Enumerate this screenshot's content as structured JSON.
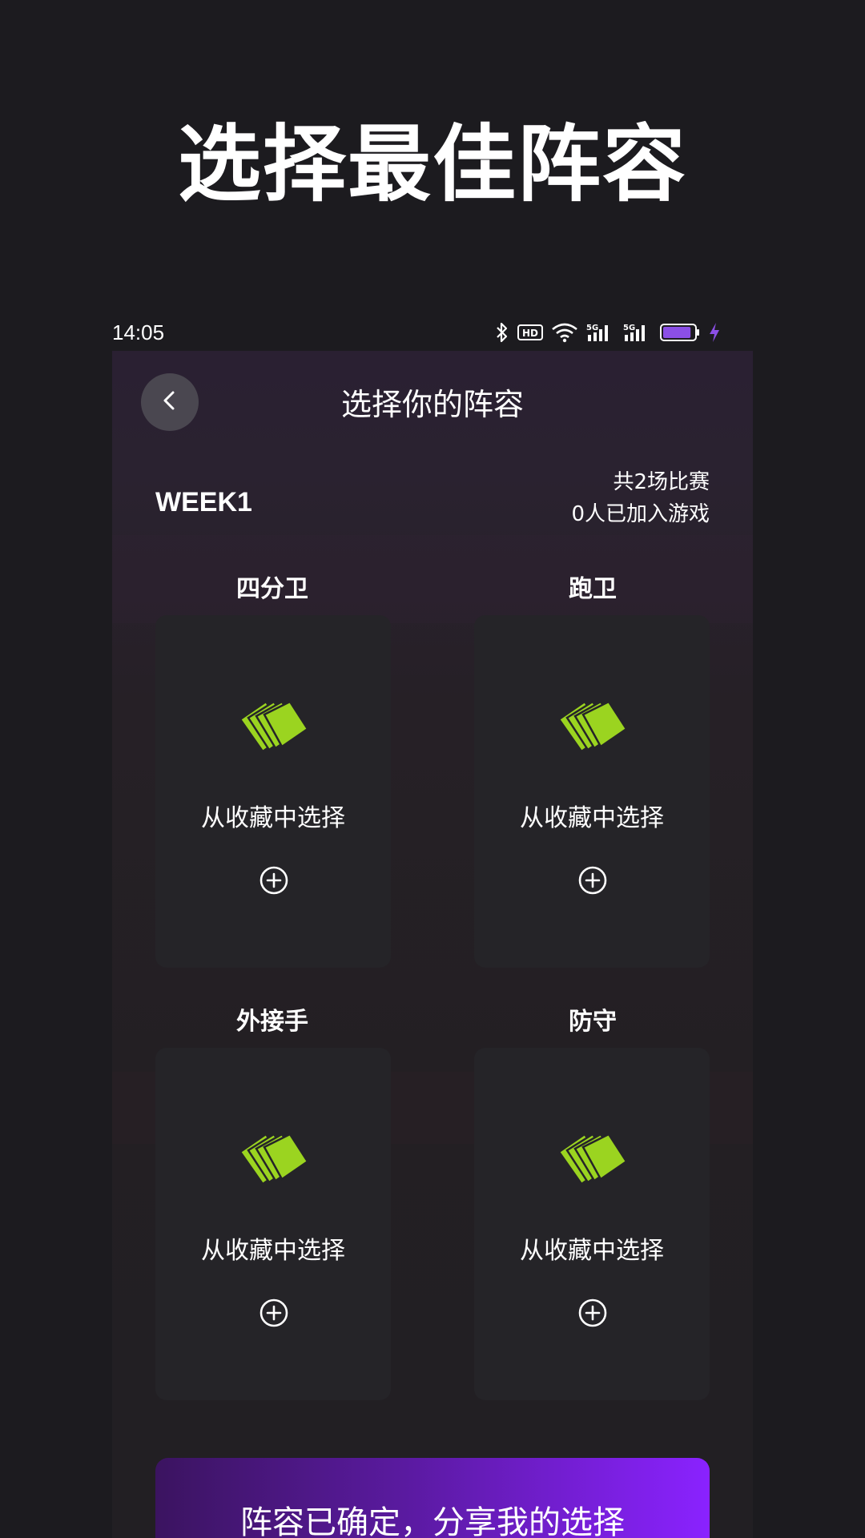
{
  "headline": "选择最佳阵容",
  "status_bar": {
    "time": "14:05",
    "icons": [
      "bluetooth-icon",
      "hd-icon",
      "wifi-icon",
      "signal-5g-icon",
      "signal-5g-icon",
      "battery-icon",
      "charging-icon"
    ],
    "hd_label": "HD",
    "net_label": "5G",
    "battery_level": 0.9
  },
  "appbar": {
    "title": "选择你的阵容",
    "back_icon": "chevron-left-icon"
  },
  "week": {
    "label": "WEEK1",
    "matches": "共2场比赛",
    "players": "0人已加入游戏"
  },
  "slots": [
    {
      "position": "四分卫",
      "action": "从收藏中选择",
      "icon": "cards-icon"
    },
    {
      "position": "跑卫",
      "action": "从收藏中选择",
      "icon": "cards-icon"
    },
    {
      "position": "外接手",
      "action": "从收藏中选择",
      "icon": "cards-icon"
    },
    {
      "position": "防守",
      "action": "从收藏中选择",
      "icon": "cards-icon"
    }
  ],
  "confirm_button": "阵容已确定，分享我的选择",
  "colors": {
    "background": "#1c1b1f",
    "card": "#252428",
    "accent_green": "#9bd420",
    "accent_purple": "#8a22ff"
  }
}
